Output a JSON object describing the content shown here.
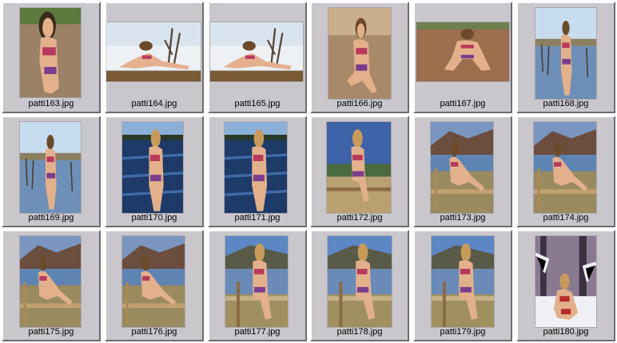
{
  "colors": {
    "cell_face": "#c9c6cc",
    "highlight": "#ffffff",
    "shadow": "#6e6c72"
  },
  "thumbnails": [
    {
      "filename": "patti163.jpg",
      "scene": "sand-portrait"
    },
    {
      "filename": "patti164.jpg",
      "scene": "lake-reclining"
    },
    {
      "filename": "patti165.jpg",
      "scene": "lake-reclining"
    },
    {
      "filename": "patti166.jpg",
      "scene": "sand-sitting"
    },
    {
      "filename": "patti167.jpg",
      "scene": "sand-crouch"
    },
    {
      "filename": "patti168.jpg",
      "scene": "lake-standing"
    },
    {
      "filename": "patti169.jpg",
      "scene": "lake-standing"
    },
    {
      "filename": "patti170.jpg",
      "scene": "water-standing"
    },
    {
      "filename": "patti171.jpg",
      "scene": "water-standing"
    },
    {
      "filename": "patti172.jpg",
      "scene": "fence-sitting"
    },
    {
      "filename": "patti173.jpg",
      "scene": "hill-fence"
    },
    {
      "filename": "patti174.jpg",
      "scene": "hill-fence"
    },
    {
      "filename": "patti175.jpg",
      "scene": "hill-fence"
    },
    {
      "filename": "patti176.jpg",
      "scene": "hill-fence"
    },
    {
      "filename": "patti177.jpg",
      "scene": "post-sitting"
    },
    {
      "filename": "patti178.jpg",
      "scene": "post-sitting"
    },
    {
      "filename": "patti179.jpg",
      "scene": "post-sitting"
    },
    {
      "filename": "patti180.jpg",
      "scene": "snow-forest"
    }
  ]
}
